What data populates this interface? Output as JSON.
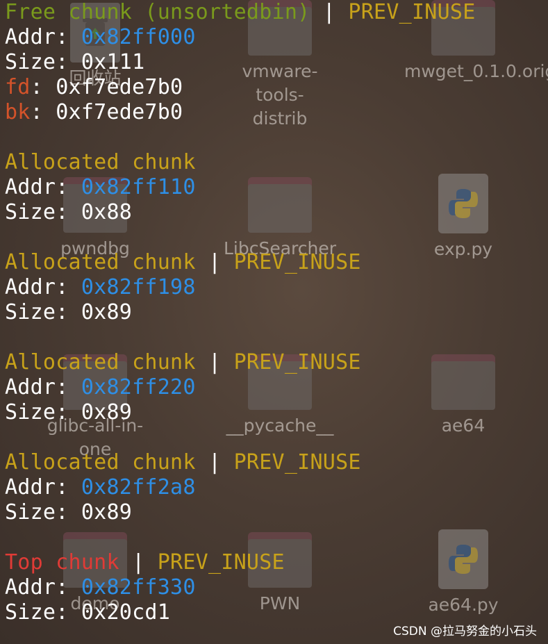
{
  "desktop": {
    "icons": [
      {
        "label": "回收站",
        "kind": "trash"
      },
      {
        "label": "vmware-tools-\ndistrib",
        "kind": "folder"
      },
      {
        "label": "mwget_0.1.0.orig",
        "kind": "folder"
      },
      {
        "label": "pwndbg",
        "kind": "folder"
      },
      {
        "label": "LibcSearcher",
        "kind": "folder"
      },
      {
        "label": "exp.py",
        "kind": "python-file"
      },
      {
        "label": "glibc-all-in-one",
        "kind": "folder"
      },
      {
        "label": "__pycache__",
        "kind": "folder"
      },
      {
        "label": "ae64",
        "kind": "folder"
      },
      {
        "label": "demo",
        "kind": "folder"
      },
      {
        "label": "PWN",
        "kind": "folder"
      },
      {
        "label": "ae64.py",
        "kind": "python-file"
      }
    ]
  },
  "heap": {
    "chunks": [
      {
        "header": "Free chunk (unsortedbin)",
        "separator": " | ",
        "flag": "PREV_INUSE",
        "addr_label": "Addr: ",
        "addr": "0x82ff000",
        "size_label": "Size: ",
        "size": "0x111",
        "fd_label": "fd",
        "fd": ": 0xf7ede7b0",
        "bk_label": "bk",
        "bk": ": 0xf7ede7b0"
      },
      {
        "header": "Allocated chunk",
        "addr_label": "Addr: ",
        "addr": "0x82ff110",
        "size_label": "Size: ",
        "size": "0x88"
      },
      {
        "header": "Allocated chunk",
        "separator": " | ",
        "flag": "PREV_INUSE",
        "addr_label": "Addr: ",
        "addr": "0x82ff198",
        "size_label": "Size: ",
        "size": "0x89"
      },
      {
        "header": "Allocated chunk",
        "separator": " | ",
        "flag": "PREV_INUSE",
        "addr_label": "Addr: ",
        "addr": "0x82ff220",
        "size_label": "Size: ",
        "size": "0x89"
      },
      {
        "header": "Allocated chunk",
        "separator": " | ",
        "flag": "PREV_INUSE",
        "addr_label": "Addr: ",
        "addr": "0x82ff2a8",
        "size_label": "Size: ",
        "size": "0x89"
      },
      {
        "header": "Top chunk",
        "separator": " | ",
        "flag": "PREV_INUSE",
        "addr_label": "Addr: ",
        "addr": "0x82ff330",
        "size_label": "Size: ",
        "size": "0x20cd1"
      }
    ]
  },
  "watermark": "CSDN @拉马努金的小石头",
  "colors": {
    "free_header": "#7a9a1c",
    "allocated_header": "#c8a21a",
    "top_header": "#e03b36",
    "flag": "#c8a21a",
    "address": "#2e8fe6",
    "pointer_label": "#d4532a",
    "text": "#ffffff"
  }
}
